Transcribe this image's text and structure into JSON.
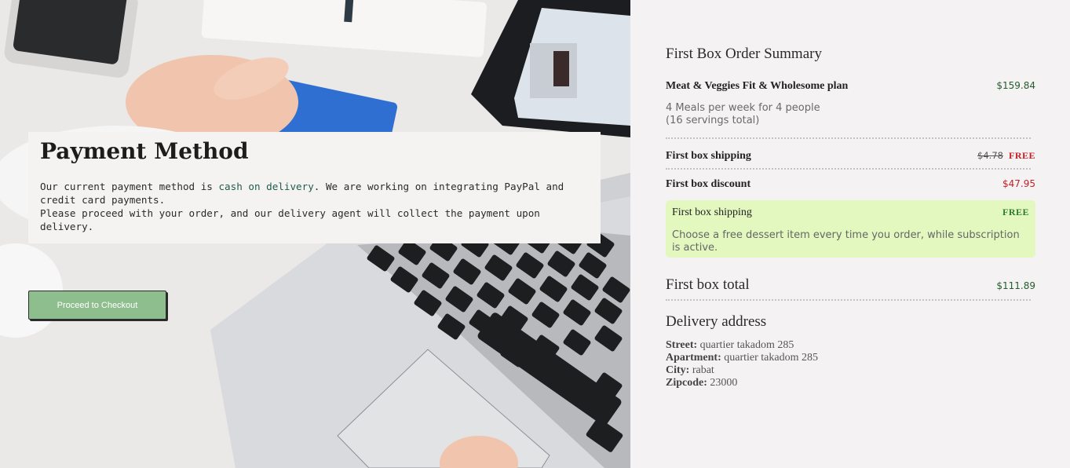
{
  "payment": {
    "title": "Payment Method",
    "text_before": "Our current payment method is ",
    "highlight": "cash on delivery",
    "text_after": ". We are working on integrating PayPal and credit card payments.\nPlease proceed with your order, and our delivery agent will collect the payment upon delivery.",
    "checkout_label": "Proceed to Checkout"
  },
  "summary": {
    "title": "First Box Order Summary",
    "plan_name": "Meat & Veggies Fit & Wholesome plan",
    "plan_price": "$159.84",
    "plan_details_1": "4 Meals per week for 4 people",
    "plan_details_2": "(16 servings total)",
    "shipping_label": "First box shipping",
    "shipping_old_price": "$4.78",
    "shipping_free": "FREE",
    "discount_label": "First box discount",
    "discount_value": "$47.95",
    "promo": {
      "label": "First box shipping",
      "badge": "FREE",
      "text": "Choose a free dessert item every time you order, while subscription is active."
    },
    "total_label": "First box total",
    "total_value": "$111.89"
  },
  "delivery": {
    "title": "Delivery address",
    "street_label": "Street:",
    "street": "quartier takadom 285",
    "apartment_label": "Apartment:",
    "apartment": "quartier takadom 285",
    "city_label": "City:",
    "city": "rabat",
    "zipcode_label": "Zipcode:",
    "zipcode": "23000"
  },
  "colors": {
    "checkout_button": "#8fbe8e",
    "price_green": "#245c2e",
    "price_red": "#c42028",
    "promo_bg": "#e3f8bf"
  }
}
